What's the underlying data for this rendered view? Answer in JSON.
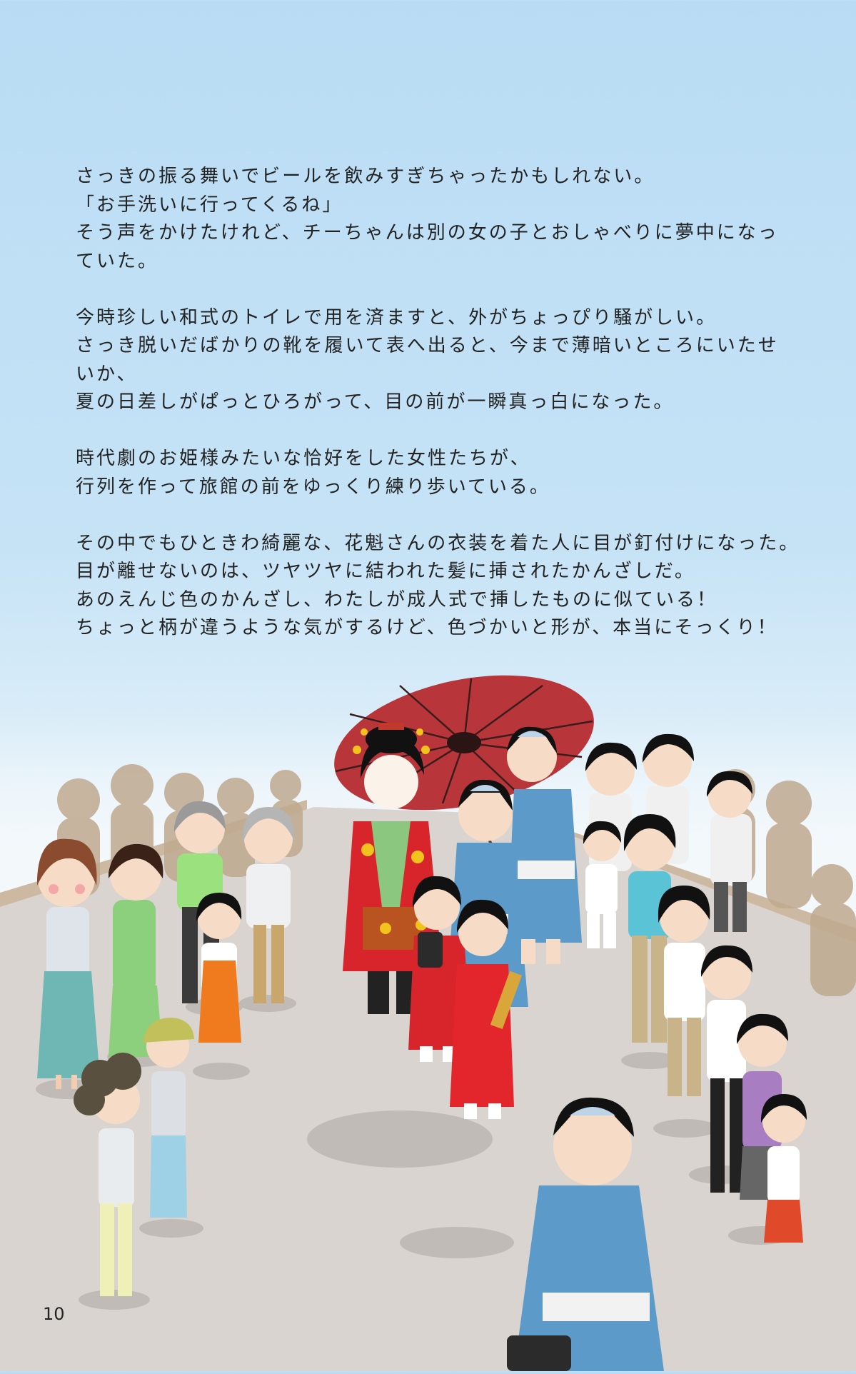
{
  "story": {
    "paragraphs": [
      {
        "lines": [
          "さっきの振る舞いでビールを飲みすぎちゃったかもしれない。",
          "「お手洗いに行ってくるね」",
          "そう声をかけたけれど、チーちゃんは別の女の子とおしゃべりに夢中になっ",
          "ていた。"
        ]
      },
      {
        "lines": [
          "今時珍しい和式のトイレで用を済ますと、外がちょっぴり騒がしい。",
          "さっき脱いだばかりの靴を履いて表へ出ると、今まで薄暗いところにいたせ",
          "いか、",
          "夏の日差しがぱっとひろがって、目の前が一瞬真っ白になった。"
        ]
      },
      {
        "lines": [
          "時代劇のお姫様みたいな恰好をした女性たちが、",
          "行列を作って旅館の前をゆっくり練り歩いている。"
        ]
      },
      {
        "lines": [
          "その中でもひときわ綺麗な、花魁さんの衣装を着た人に目が釘付けになった。",
          "目が離せないのは、ツヤツヤに結われた髪に挿されたかんざしだ。",
          "あのえんじ色のかんざし、わたしが成人式で挿したものに似ている！",
          "ちょっと柄が違うような気がするけど、色づかいと形が、本当にそっくり！"
        ]
      }
    ]
  },
  "page_number": "10",
  "colors": {
    "sky_top": "#b9dcf4",
    "ground": "#d9d4cf",
    "umbrella": "#b8363a",
    "yukata": "#5c9ac9",
    "kimono_red": "#d8252b"
  },
  "illustration": {
    "icon": "oiran-procession-illustration"
  }
}
